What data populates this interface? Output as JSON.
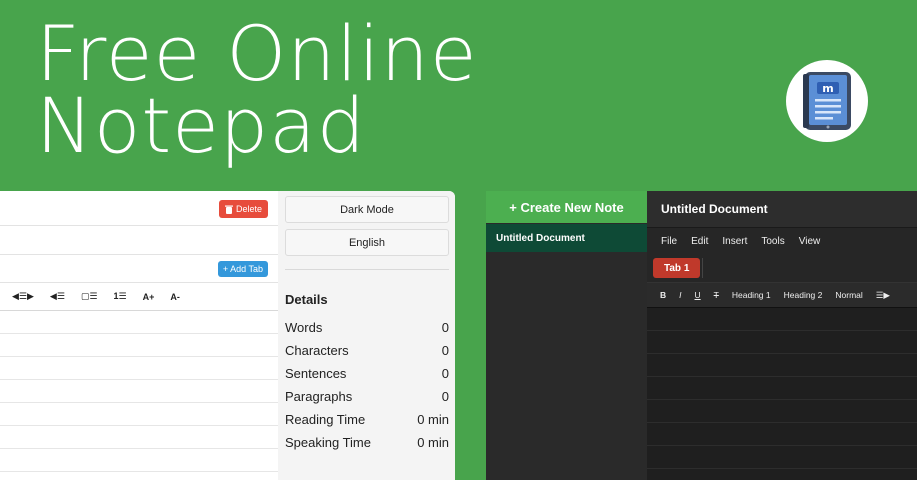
{
  "hero": {
    "line1": "Free Online",
    "line2": "Notepad"
  },
  "light": {
    "delete_label": "Delete",
    "add_tab_label": "+ Add Tab",
    "toolbar": [
      "◀☰▶",
      "◀☰",
      "▢☰",
      "1☰",
      "A+",
      "A-"
    ],
    "buttons": {
      "dark_mode": "Dark Mode",
      "language": "English"
    },
    "details_title": "Details",
    "stats": [
      {
        "label": "Words",
        "value": "0"
      },
      {
        "label": "Characters",
        "value": "0"
      },
      {
        "label": "Sentences",
        "value": "0"
      },
      {
        "label": "Paragraphs",
        "value": "0"
      },
      {
        "label": "Reading Time",
        "value": "0 min"
      },
      {
        "label": "Speaking Time",
        "value": "0 min"
      }
    ]
  },
  "dark": {
    "create_label": "+ Create New Note",
    "note_item": "Untitled Document",
    "doc_title": "Untitled Document",
    "menu": [
      "File",
      "Edit",
      "Insert",
      "Tools",
      "View"
    ],
    "tab_label": "Tab 1",
    "toolbar": [
      "B",
      "I",
      "U",
      "T",
      "Heading 1",
      "Heading 2",
      "Normal",
      "☰▶"
    ]
  },
  "colors": {
    "brand_green": "#48a44c",
    "delete_red": "#e74c3c",
    "add_tab_blue": "#3498db",
    "tab_red": "#c0392b"
  }
}
